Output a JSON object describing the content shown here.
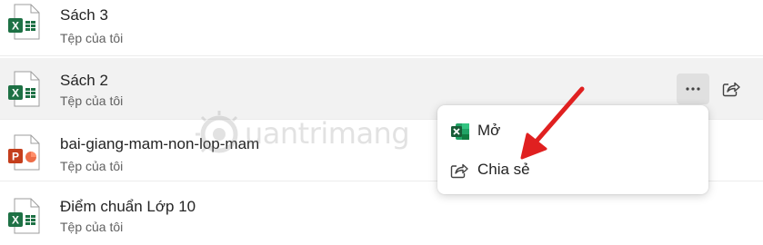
{
  "files": [
    {
      "name": "Sách 3",
      "location": "Tệp của tôi",
      "type": "excel",
      "icon_letter": "X"
    },
    {
      "name": "Sách 2",
      "location": "Tệp của tôi",
      "type": "excel",
      "icon_letter": "X"
    },
    {
      "name": "bai-giang-mam-non-lop-mam",
      "location": "Tệp của tôi",
      "type": "powerpoint",
      "icon_letter": "P"
    },
    {
      "name": "Điểm chuẩn Lớp 10",
      "location": "Tệp của tôi",
      "type": "excel",
      "icon_letter": "X"
    }
  ],
  "row_actions": {
    "more_label": "···",
    "more_icon": "more-icon",
    "share_icon": "share-icon"
  },
  "context_menu": {
    "open_label": "Mở",
    "open_icon": "excel-icon",
    "share_label": "Chia sẻ",
    "share_icon": "share-icon"
  },
  "watermark": {
    "text": "uantrimang"
  },
  "colors": {
    "excel": "#1e7145",
    "powerpoint": "#c43e1c",
    "arrow": "#e02020",
    "hover_row": "#f2f2f2"
  }
}
